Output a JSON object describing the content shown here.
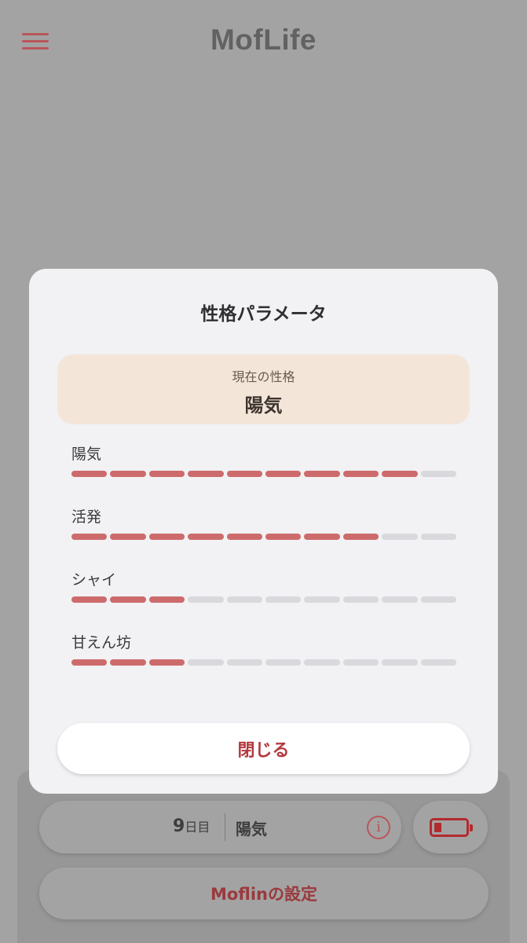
{
  "header": {
    "logo": "MofLife"
  },
  "modal": {
    "title": "性格パラメータ",
    "current_label": "現在の性格",
    "current_value": "陽気",
    "segments_total": 10,
    "params": [
      {
        "label": "陽気",
        "level": 9
      },
      {
        "label": "活発",
        "level": 8
      },
      {
        "label": "シャイ",
        "level": 3
      },
      {
        "label": "甘えん坊",
        "level": 3
      }
    ],
    "close_label": "閉じる"
  },
  "status": {
    "day_number": "9",
    "day_unit": "日目",
    "personality": "陽気",
    "info_icon": "i",
    "battery_level": 0.2
  },
  "settings_button": "Moflinの設定",
  "colors": {
    "accent": "#b9565a",
    "bar_on": "#cd6b6c",
    "bar_off": "#d9d8dd",
    "current_box": "#f3e6d9"
  }
}
